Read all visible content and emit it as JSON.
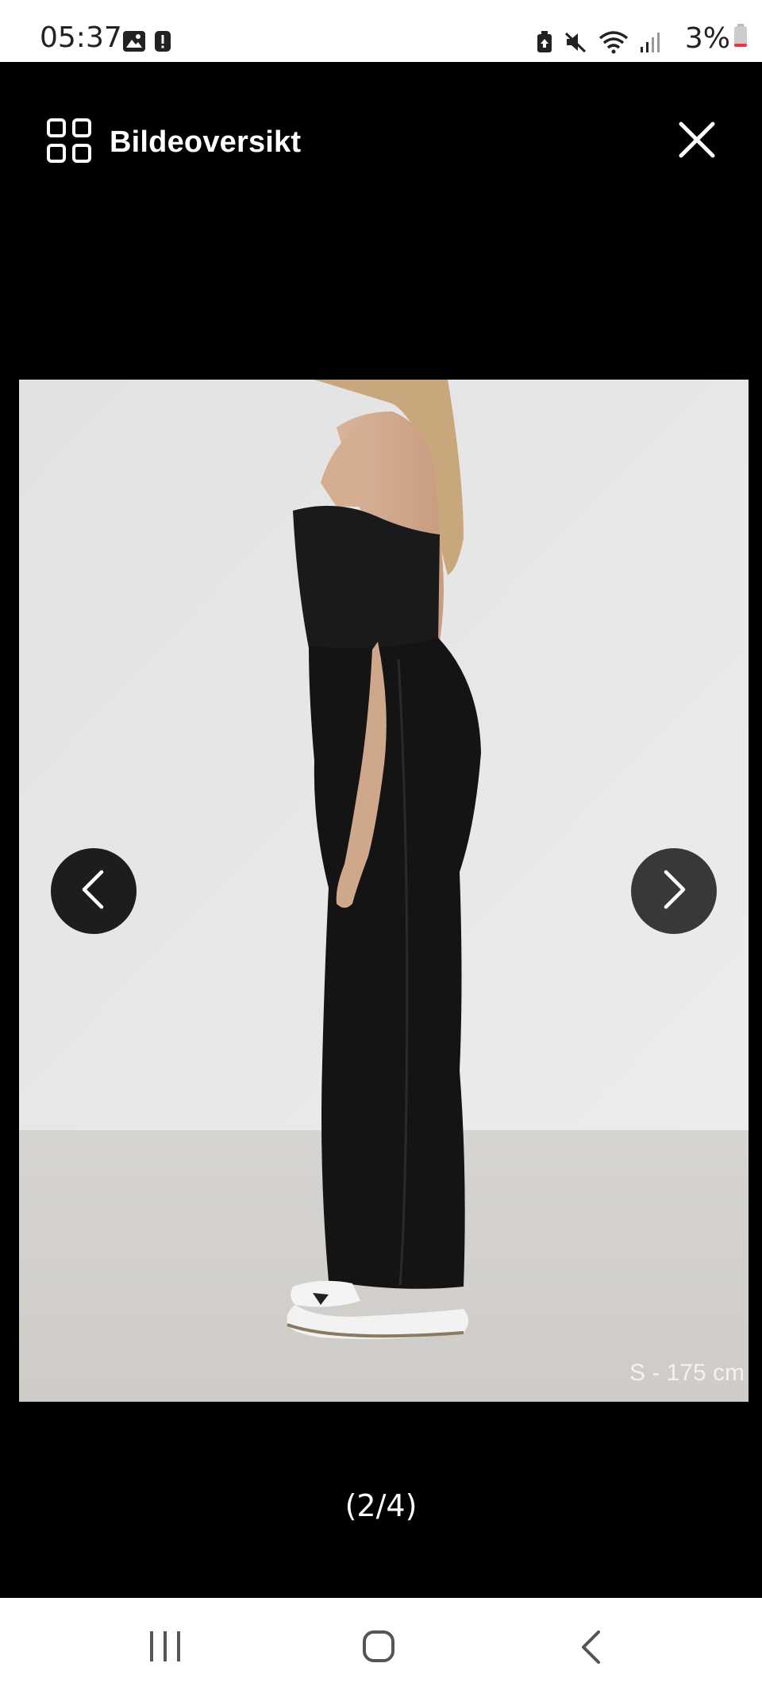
{
  "status_bar": {
    "time": "05:37",
    "battery_text": "3%",
    "icons": [
      "gallery-icon",
      "alert-icon",
      "battery-saver-icon",
      "mute-icon",
      "wifi-icon",
      "signal-icon",
      "battery-icon"
    ]
  },
  "viewer": {
    "overview_label": "Bildeoversikt",
    "overview_icon": "grid-icon",
    "close_icon": "close-icon",
    "prev_icon": "chevron-left-icon",
    "next_icon": "chevron-right-icon",
    "photo_caption": "S - 175 cm",
    "counter": "(2/4)"
  },
  "nav_bar": {
    "icons": [
      "recents-icon",
      "home-icon",
      "back-icon"
    ]
  },
  "colors": {
    "viewer_bg": "#000000",
    "nav_button_bg": "#1d1d1d",
    "photo_wall": "#e9e9e9",
    "photo_floor": "#d4d2cf"
  }
}
